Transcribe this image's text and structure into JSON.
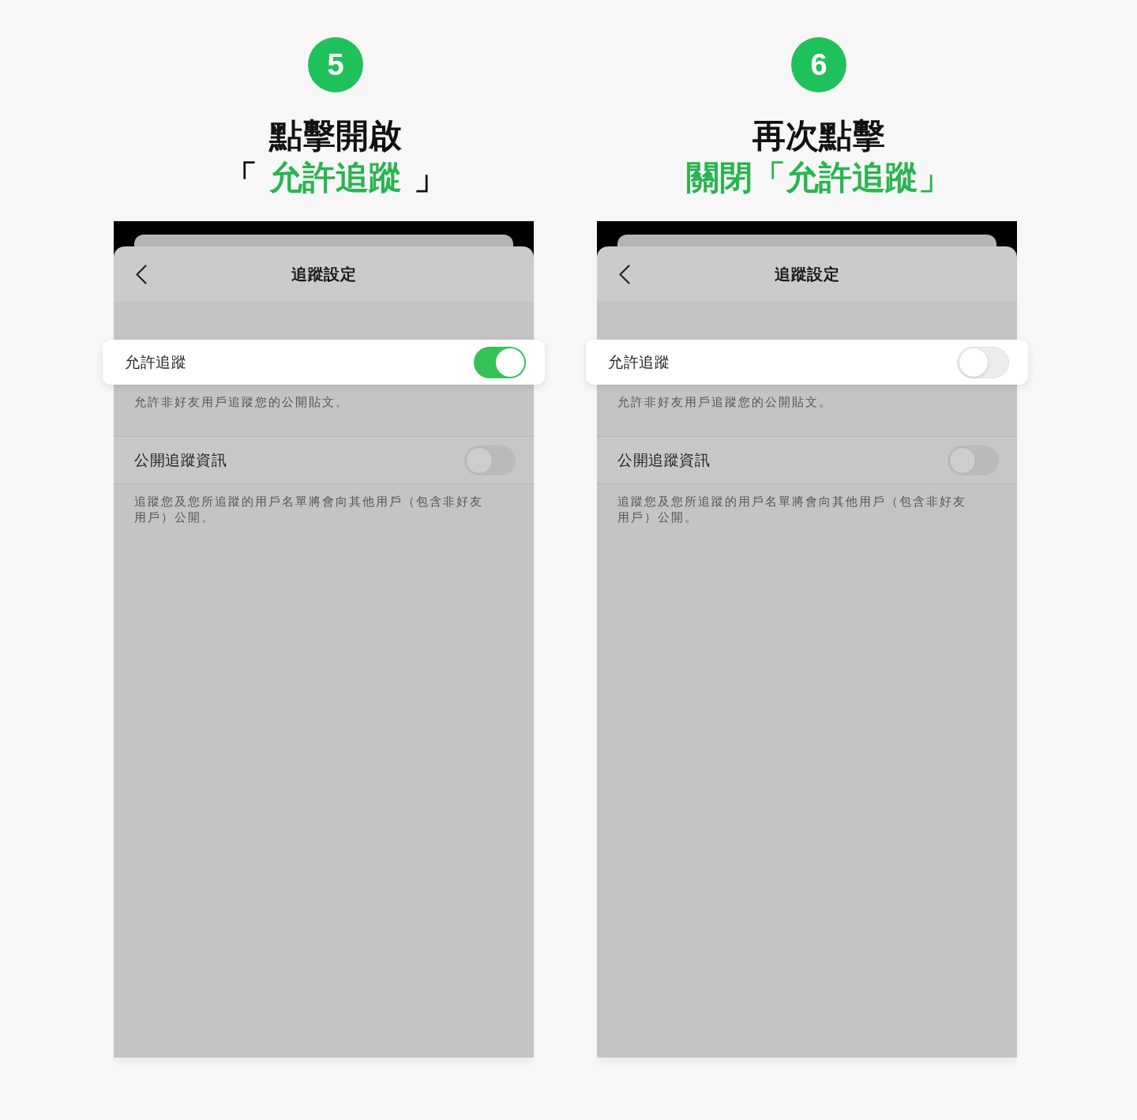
{
  "steps": [
    {
      "number": "5",
      "heading": [
        {
          "segments": [
            {
              "kind": "plain",
              "text": "點擊開啟"
            }
          ]
        },
        {
          "segments": [
            {
              "kind": "plain",
              "text": "「 "
            },
            {
              "kind": "highlight",
              "text": "允許追蹤"
            },
            {
              "kind": "plain",
              "text": " 」"
            }
          ]
        }
      ],
      "screen": {
        "title": "追蹤設定",
        "settings": [
          {
            "label": "允許追蹤",
            "on": true,
            "highlighted": true,
            "description": "允許非好友用戶追蹤您的公開貼文。"
          },
          {
            "label": "公開追蹤資訊",
            "on": false,
            "highlighted": false,
            "description": "追蹤您及您所追蹤的用戶名單將會向其他用戶（包含非好友用戶）公開。"
          }
        ]
      }
    },
    {
      "number": "6",
      "heading": [
        {
          "segments": [
            {
              "kind": "plain",
              "text": "再次點擊"
            }
          ]
        },
        {
          "segments": [
            {
              "kind": "highlight",
              "text": "關閉「允許追蹤」"
            }
          ]
        }
      ],
      "screen": {
        "title": "追蹤設定",
        "settings": [
          {
            "label": "允許追蹤",
            "on": false,
            "highlighted": true,
            "description": "允許非好友用戶追蹤您的公開貼文。"
          },
          {
            "label": "公開追蹤資訊",
            "on": false,
            "highlighted": false,
            "description": "追蹤您及您所追蹤的用戶名單將會向其他用戶（包含非好友用戶）公開。"
          }
        ]
      }
    }
  ]
}
